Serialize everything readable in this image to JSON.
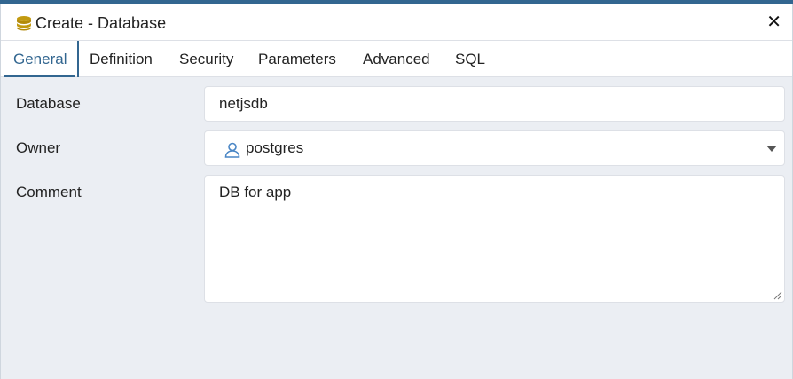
{
  "dialog": {
    "title": "Create - Database",
    "close_glyph": "✕",
    "icon": "database-icon"
  },
  "tabs": [
    {
      "label": "General",
      "active": true
    },
    {
      "label": "Definition"
    },
    {
      "label": "Security"
    },
    {
      "label": "Parameters"
    },
    {
      "label": "Advanced"
    },
    {
      "label": "SQL"
    }
  ],
  "form": {
    "database": {
      "label": "Database",
      "value": "netjsdb"
    },
    "owner": {
      "label": "Owner",
      "value": "postgres",
      "icon": "user-icon"
    },
    "comment": {
      "label": "Comment",
      "value": "DB for app"
    }
  },
  "colors": {
    "accent": "#326690",
    "background": "#ebeef3",
    "db_icon": "#c29a10",
    "user_icon": "#4a86c5"
  }
}
